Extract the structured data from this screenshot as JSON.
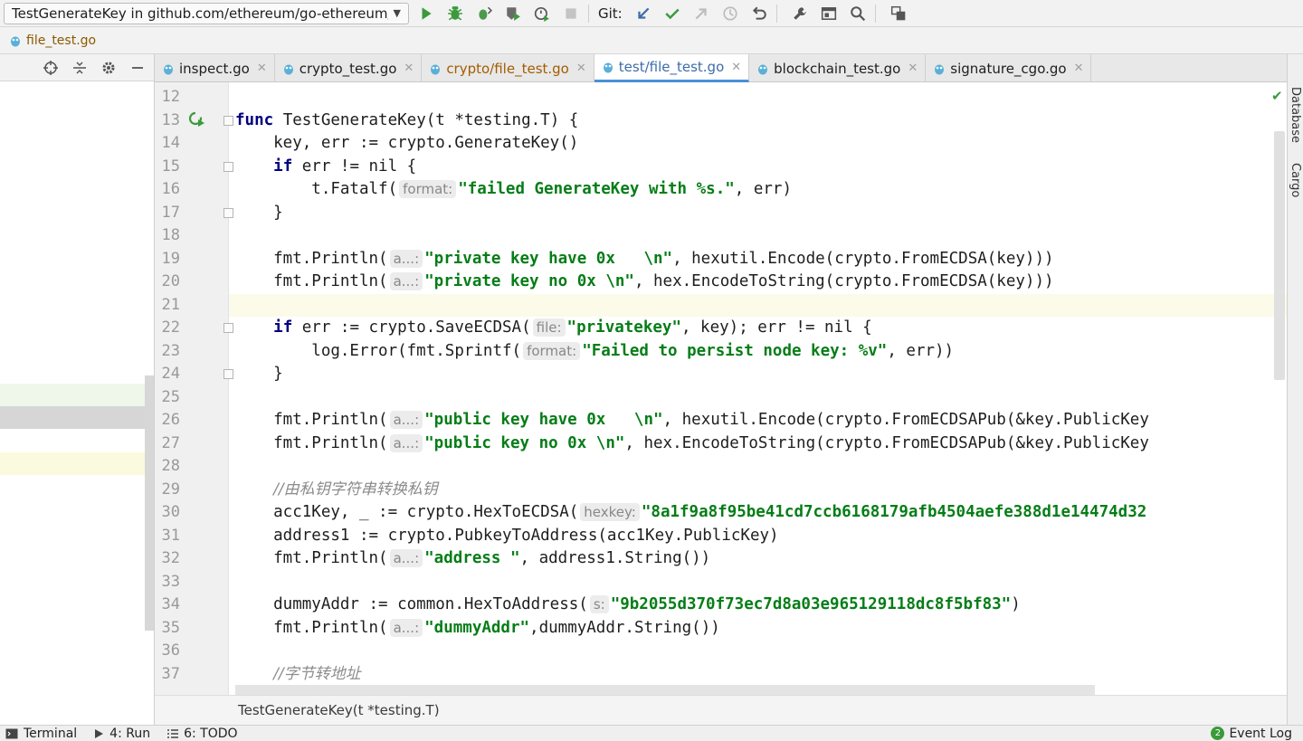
{
  "toolbar": {
    "run_config": "TestGenerateKey in github.com/ethereum/go-ethereum/test",
    "git_label": "Git:"
  },
  "navbar": {
    "file": "file_test.go"
  },
  "tabs": [
    {
      "label": "inspect.go",
      "state": "normal"
    },
    {
      "label": "crypto_test.go",
      "state": "normal"
    },
    {
      "label": "crypto/file_test.go",
      "state": "modified"
    },
    {
      "label": "test/file_test.go",
      "state": "active"
    },
    {
      "label": "blockchain_test.go",
      "state": "normal"
    },
    {
      "label": "signature_cgo.go",
      "state": "normal"
    }
  ],
  "editor": {
    "first_line": 12,
    "cursor_line": 21,
    "lines": [
      {
        "n": 12,
        "parts": []
      },
      {
        "n": 13,
        "parts": [
          {
            "k": "kw",
            "t": "func"
          },
          {
            "k": "t",
            "t": " TestGenerateKey(t *testing.T) {"
          }
        ]
      },
      {
        "n": 14,
        "parts": [
          {
            "k": "t",
            "t": "    key, err := crypto.GenerateKey()"
          }
        ]
      },
      {
        "n": 15,
        "parts": [
          {
            "k": "t",
            "t": "    "
          },
          {
            "k": "kw",
            "t": "if"
          },
          {
            "k": "t",
            "t": " err != nil {"
          }
        ]
      },
      {
        "n": 16,
        "parts": [
          {
            "k": "t",
            "t": "        t.Fatalf("
          },
          {
            "k": "hint",
            "t": "format:"
          },
          {
            "k": "str",
            "t": "\"failed GenerateKey with %s.\""
          },
          {
            "k": "t",
            "t": ", err)"
          }
        ]
      },
      {
        "n": 17,
        "parts": [
          {
            "k": "t",
            "t": "    }"
          }
        ]
      },
      {
        "n": 18,
        "parts": []
      },
      {
        "n": 19,
        "parts": [
          {
            "k": "t",
            "t": "    fmt.Println("
          },
          {
            "k": "hint",
            "t": "a...:"
          },
          {
            "k": "str",
            "t": "\"private key have 0x   \\n\""
          },
          {
            "k": "t",
            "t": ", hexutil.Encode(crypto.FromECDSA(key)))"
          }
        ]
      },
      {
        "n": 20,
        "parts": [
          {
            "k": "t",
            "t": "    fmt.Println("
          },
          {
            "k": "hint",
            "t": "a...:"
          },
          {
            "k": "str",
            "t": "\"private key no 0x \\n\""
          },
          {
            "k": "t",
            "t": ", hex.EncodeToString(crypto.FromECDSA(key)))"
          }
        ]
      },
      {
        "n": 21,
        "parts": []
      },
      {
        "n": 22,
        "parts": [
          {
            "k": "t",
            "t": "    "
          },
          {
            "k": "kw",
            "t": "if"
          },
          {
            "k": "t",
            "t": " err := crypto.SaveECDSA("
          },
          {
            "k": "hint",
            "t": "file:"
          },
          {
            "k": "str",
            "t": "\"privatekey\""
          },
          {
            "k": "t",
            "t": ", key); err != nil {"
          }
        ]
      },
      {
        "n": 23,
        "parts": [
          {
            "k": "t",
            "t": "        log.Error(fmt.Sprintf("
          },
          {
            "k": "hint",
            "t": "format:"
          },
          {
            "k": "str",
            "t": "\"Failed to persist node key: %v\""
          },
          {
            "k": "t",
            "t": ", err))"
          }
        ]
      },
      {
        "n": 24,
        "parts": [
          {
            "k": "t",
            "t": "    }"
          }
        ]
      },
      {
        "n": 25,
        "parts": []
      },
      {
        "n": 26,
        "parts": [
          {
            "k": "t",
            "t": "    fmt.Println("
          },
          {
            "k": "hint",
            "t": "a...:"
          },
          {
            "k": "str",
            "t": "\"public key have 0x   \\n\""
          },
          {
            "k": "t",
            "t": ", hexutil.Encode(crypto.FromECDSAPub(&key.PublicKey"
          }
        ]
      },
      {
        "n": 27,
        "parts": [
          {
            "k": "t",
            "t": "    fmt.Println("
          },
          {
            "k": "hint",
            "t": "a...:"
          },
          {
            "k": "str",
            "t": "\"public key no 0x \\n\""
          },
          {
            "k": "t",
            "t": ", hex.EncodeToString(crypto.FromECDSAPub(&key.PublicKey"
          }
        ]
      },
      {
        "n": 28,
        "parts": []
      },
      {
        "n": 29,
        "parts": [
          {
            "k": "t",
            "t": "    "
          },
          {
            "k": "cmt",
            "t": "//由私钥字符串转换私钥"
          }
        ]
      },
      {
        "n": 30,
        "parts": [
          {
            "k": "t",
            "t": "    acc1Key, _ := crypto.HexToECDSA("
          },
          {
            "k": "hint",
            "t": "hexkey:"
          },
          {
            "k": "str",
            "t": "\"8a1f9a8f95be41cd7ccb6168179afb4504aefe388d1e14474d32"
          }
        ]
      },
      {
        "n": 31,
        "parts": [
          {
            "k": "t",
            "t": "    address1 := crypto.PubkeyToAddress(acc1Key.PublicKey)"
          }
        ]
      },
      {
        "n": 32,
        "parts": [
          {
            "k": "t",
            "t": "    fmt.Println("
          },
          {
            "k": "hint",
            "t": "a...:"
          },
          {
            "k": "str",
            "t": "\"address \""
          },
          {
            "k": "t",
            "t": ", address1.String())"
          }
        ]
      },
      {
        "n": 33,
        "parts": []
      },
      {
        "n": 34,
        "parts": [
          {
            "k": "t",
            "t": "    dummyAddr := common.HexToAddress("
          },
          {
            "k": "hint",
            "t": "s:"
          },
          {
            "k": "str",
            "t": "\"9b2055d370f73ec7d8a03e965129118dc8f5bf83\""
          },
          {
            "k": "t",
            "t": ")"
          }
        ]
      },
      {
        "n": 35,
        "parts": [
          {
            "k": "t",
            "t": "    fmt.Println("
          },
          {
            "k": "hint",
            "t": "a...:"
          },
          {
            "k": "str",
            "t": "\"dummyAddr\""
          },
          {
            "k": "t",
            "t": ",dummyAddr.String())"
          }
        ]
      },
      {
        "n": 36,
        "parts": []
      },
      {
        "n": 37,
        "parts": [
          {
            "k": "t",
            "t": "    "
          },
          {
            "k": "cmt",
            "t": "//字节转地址"
          }
        ]
      }
    ],
    "fold_lines": [
      13,
      15,
      17,
      22,
      24
    ]
  },
  "crumb": "TestGenerateKey(t *testing.T)",
  "right_rail": {
    "database": "Database",
    "cargo": "Cargo"
  },
  "statusbar": {
    "terminal": "Terminal",
    "run": "4: Run",
    "todo": "6: TODO",
    "event_log": "Event Log",
    "event_count": "2"
  },
  "colors": {
    "keyword": "#000080",
    "string": "#067d17",
    "comment": "#8c8c8c",
    "active_tab": "#4a90d9",
    "run_green": "#3c9a3c"
  }
}
